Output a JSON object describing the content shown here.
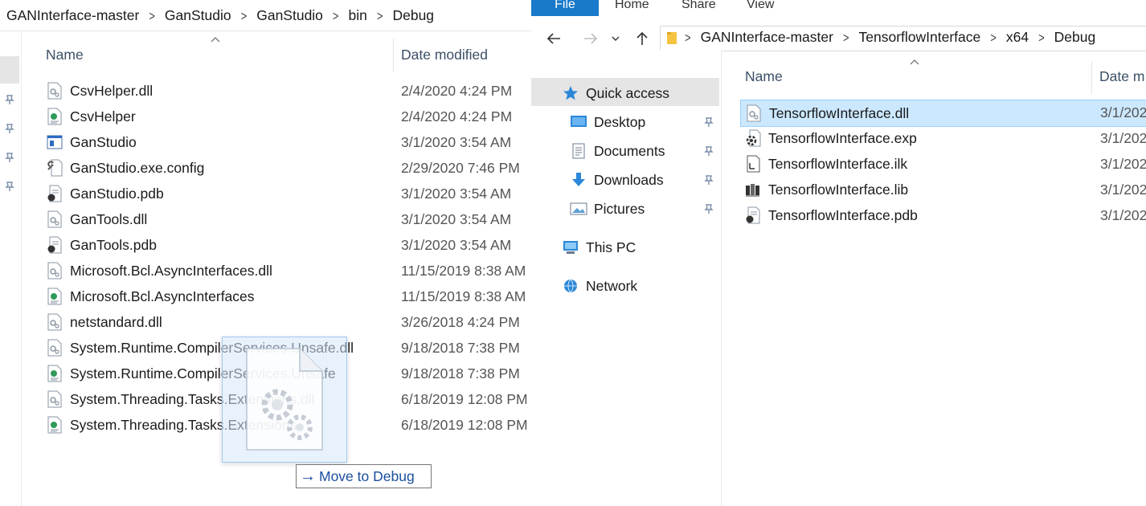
{
  "left_window": {
    "breadcrumb": [
      "GANInterface-master",
      "GanStudio",
      "GanStudio",
      "bin",
      "Debug"
    ],
    "columns": {
      "name": "Name",
      "date": "Date modified"
    },
    "files": [
      {
        "name": "CsvHelper.dll",
        "date": "2/4/2020 4:24 PM",
        "icon": "dll-icon"
      },
      {
        "name": "CsvHelper",
        "date": "2/4/2020 4:24 PM",
        "icon": "xml-doc-icon"
      },
      {
        "name": "GanStudio",
        "date": "3/1/2020 3:54 AM",
        "icon": "exe-icon"
      },
      {
        "name": "GanStudio.exe.config",
        "date": "2/29/2020 7:46 PM",
        "icon": "config-icon"
      },
      {
        "name": "GanStudio.pdb",
        "date": "3/1/2020 3:54 AM",
        "icon": "pdb-icon"
      },
      {
        "name": "GanTools.dll",
        "date": "3/1/2020 3:54 AM",
        "icon": "dll-icon"
      },
      {
        "name": "GanTools.pdb",
        "date": "3/1/2020 3:54 AM",
        "icon": "pdb-icon"
      },
      {
        "name": "Microsoft.Bcl.AsyncInterfaces.dll",
        "date": "11/15/2019 8:38 AM",
        "icon": "dll-icon"
      },
      {
        "name": "Microsoft.Bcl.AsyncInterfaces",
        "date": "11/15/2019 8:38 AM",
        "icon": "xml-doc-icon"
      },
      {
        "name": "netstandard.dll",
        "date": "3/26/2018 4:24 PM",
        "icon": "dll-icon"
      },
      {
        "name": "System.Runtime.CompilerServices.Unsafe.dll",
        "date": "9/18/2018 7:38 PM",
        "icon": "dll-icon"
      },
      {
        "name": "System.Runtime.CompilerServices.Unsafe",
        "date": "9/18/2018 7:38 PM",
        "icon": "xml-doc-icon"
      },
      {
        "name": "System.Threading.Tasks.Extensions.dll",
        "date": "6/18/2019 12:08 PM",
        "icon": "dll-icon"
      },
      {
        "name": "System.Threading.Tasks.Extensions",
        "date": "6/18/2019 12:08 PM",
        "icon": "xml-doc-icon"
      }
    ]
  },
  "right_window": {
    "ribbon_tabs": [
      "File",
      "Home",
      "Share",
      "View"
    ],
    "breadcrumb": [
      "GANInterface-master",
      "TensorflowInterface",
      "x64",
      "Debug"
    ],
    "columns": {
      "name": "Name",
      "date": "Date m"
    },
    "nav": {
      "quick_access": "Quick access",
      "pinned": [
        "Desktop",
        "Documents",
        "Downloads",
        "Pictures"
      ],
      "this_pc": "This PC",
      "network": "Network"
    },
    "files": [
      {
        "name": "TensorflowInterface.dll",
        "date": "3/1/202",
        "icon": "dll-icon"
      },
      {
        "name": "TensorflowInterface.exp",
        "date": "3/1/202",
        "icon": "exp-icon"
      },
      {
        "name": "TensorflowInterface.ilk",
        "date": "3/1/202",
        "icon": "ilk-icon"
      },
      {
        "name": "TensorflowInterface.lib",
        "date": "3/1/202",
        "icon": "lib-icon"
      },
      {
        "name": "TensorflowInterface.pdb",
        "date": "3/1/202",
        "icon": "pdb-icon"
      }
    ],
    "selected_index": 0
  },
  "drag": {
    "tooltip_arrow": "→",
    "tooltip_text": "Move to Debug"
  },
  "colors": {
    "accent": "#1979ca",
    "selection": "#cce8ff",
    "selection_border": "#99d1ff",
    "nav_selected": "#e5e5e5",
    "header_text": "#3c4f66"
  }
}
